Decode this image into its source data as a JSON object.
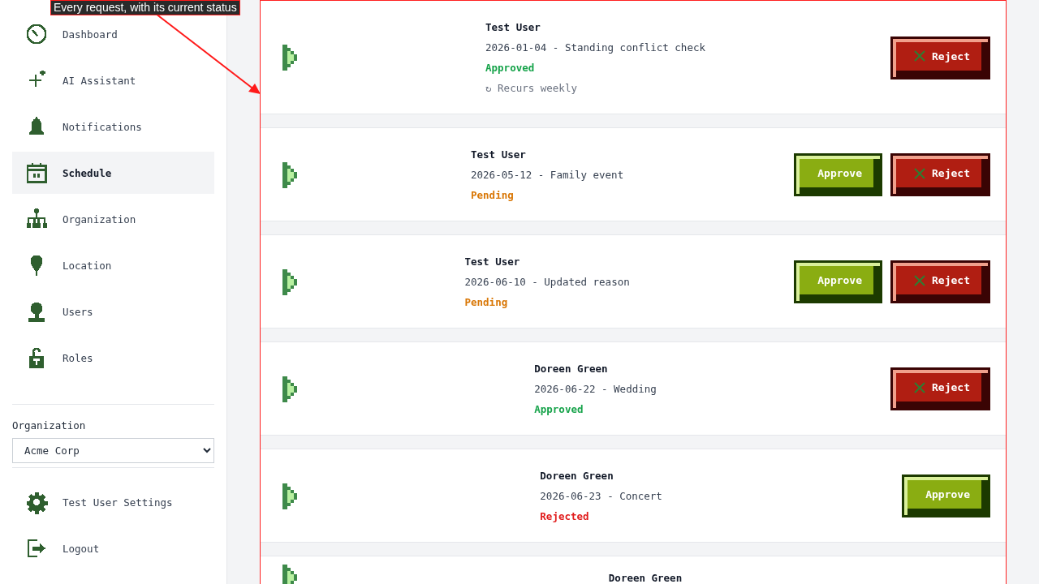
{
  "callout": {
    "text": "Every request, with its current status"
  },
  "sidebar": {
    "items": [
      {
        "label": "Dashboard",
        "selected": false
      },
      {
        "label": "AI Assistant",
        "selected": false
      },
      {
        "label": "Notifications",
        "selected": false
      },
      {
        "label": "Schedule",
        "selected": true
      },
      {
        "label": "Organization",
        "selected": false
      },
      {
        "label": "Location",
        "selected": false
      },
      {
        "label": "Users",
        "selected": false
      },
      {
        "label": "Roles",
        "selected": false
      }
    ],
    "organization": {
      "label": "Organization",
      "value": "Acme Corp"
    },
    "footer_items": [
      {
        "label": "Test User Settings"
      },
      {
        "label": "Logout"
      }
    ]
  },
  "requests": [
    {
      "name": "Test User",
      "detail": "2026-01-04 - Standing conflict check",
      "status": "Approved",
      "color": "#16a34a",
      "recurrence": "↻ Recurs weekly",
      "actions": [
        {
          "kind": "reject",
          "label": "Reject"
        }
      ]
    },
    {
      "name": "Test User",
      "detail": "2026-05-12 - Family event",
      "status": "Pending",
      "color": "#d97706",
      "actions": [
        {
          "kind": "approve",
          "label": "Approve"
        },
        {
          "kind": "reject",
          "label": "Reject"
        }
      ]
    },
    {
      "name": "Test User",
      "detail": "2026-06-10 - Updated reason",
      "status": "Pending",
      "color": "#d97706",
      "actions": [
        {
          "kind": "approve",
          "label": "Approve"
        },
        {
          "kind": "reject",
          "label": "Reject"
        }
      ]
    },
    {
      "name": "Doreen Green",
      "detail": "2026-06-22 - Wedding",
      "status": "Approved",
      "color": "#16a34a",
      "actions": [
        {
          "kind": "reject",
          "label": "Reject"
        }
      ]
    },
    {
      "name": "Doreen Green",
      "detail": "2026-06-23 - Concert",
      "status": "Rejected",
      "color": "#e11d1d",
      "actions": [
        {
          "kind": "approve",
          "label": "Approve"
        }
      ]
    },
    {
      "name": "Doreen Green"
    }
  ]
}
